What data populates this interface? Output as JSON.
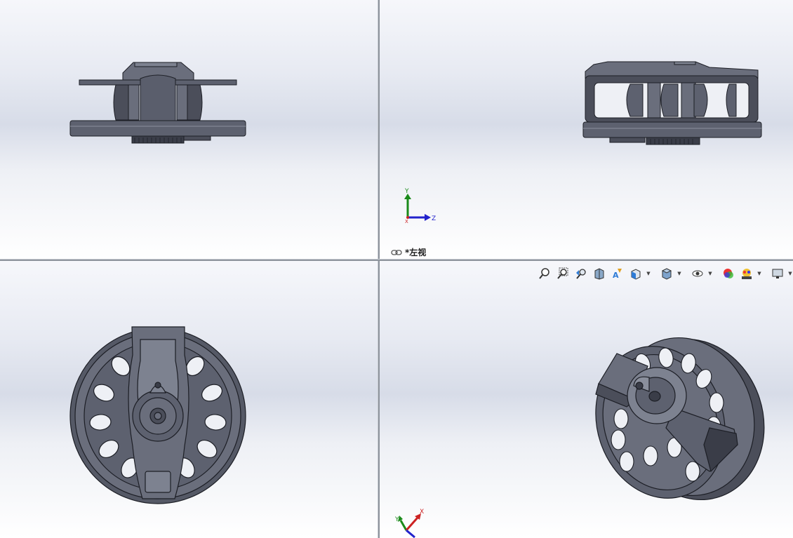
{
  "viewports": {
    "top_left": {
      "name": "front-view"
    },
    "top_right": {
      "name": "left-view",
      "label": "*左视",
      "triad": {
        "y": "Y",
        "z": "Z",
        "x": "X"
      }
    },
    "bottom_left": {
      "name": "top-view"
    },
    "bottom_right": {
      "name": "isometric-view",
      "triad": {
        "y": "Y",
        "x": "X"
      }
    }
  },
  "heads_up_toolbar": {
    "items": [
      {
        "icon": "zoom-to-fit-icon"
      },
      {
        "icon": "zoom-to-area-icon"
      },
      {
        "icon": "previous-view-icon"
      },
      {
        "icon": "section-view-icon"
      },
      {
        "icon": "dynamic-annotation-views-icon"
      },
      {
        "icon": "view-orientation-icon",
        "dropdown": true
      },
      {
        "icon": "display-style-icon",
        "dropdown": true
      },
      {
        "icon": "hide-show-items-icon",
        "dropdown": true
      },
      {
        "icon": "edit-appearance-icon"
      },
      {
        "icon": "apply-scene-icon",
        "dropdown": true
      },
      {
        "icon": "view-settings-icon",
        "dropdown": true
      }
    ]
  },
  "colors": {
    "model_face": "#5d616f",
    "model_dark": "#3a3d48",
    "model_light": "#8a8f9c",
    "axis_y": "#1a8a1a",
    "axis_z": "#2222cc",
    "axis_x": "#cc2222"
  }
}
